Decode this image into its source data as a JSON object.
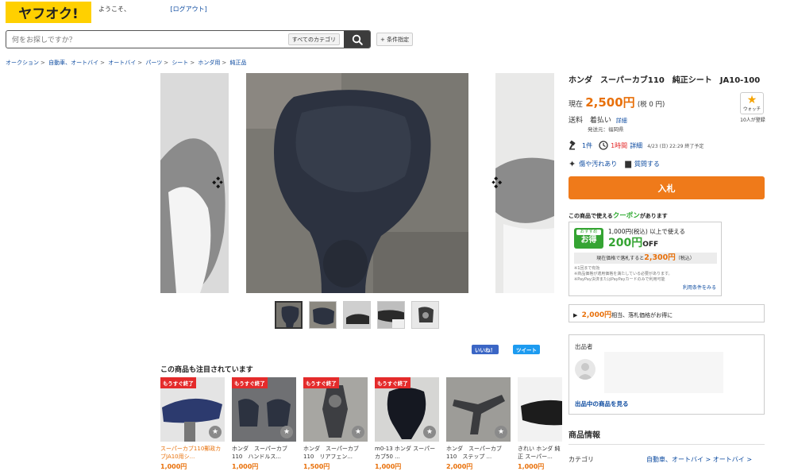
{
  "header": {
    "logo": "ヤフオク!",
    "welcome": "ようこそ、",
    "logout": "[ログアウト]"
  },
  "search": {
    "placeholder": "何をお探しですか？",
    "category": "すべてのカテゴリ",
    "search_icon": "search-icon",
    "conditions": "+ 条件指定"
  },
  "breadcrumbs": [
    "オークション",
    "自動車、オートバイ",
    "オートバイ",
    "パーツ",
    "シート",
    "ホンダ用",
    "純正品"
  ],
  "product": {
    "title": "ホンダ　スーパーカブ110　純正シート　JA10-100",
    "current_label": "現在",
    "price": "2,500円",
    "tax": "(税 0 円)",
    "watch_label": "ウォッチ",
    "watch_count": "10人が登録",
    "shipping_label": "送料",
    "shipping_value": "着払い",
    "shipping_detail": "詳細",
    "ship_from": "発送元：福岡県",
    "bid_count": "1件",
    "time_left": "1時間",
    "time_detail": "詳細",
    "end_time": "4/23 (日) 22:29 終了予定",
    "condition": "傷や汚れあり",
    "question": "質問する",
    "bid_button": "入札"
  },
  "coupon": {
    "heading_pre": "この商品で使える",
    "heading_em": "クーポン",
    "heading_post": "があります",
    "tag_small": "おすすめ",
    "tag_big": "お得",
    "line1": "1,000円(税込) 以上で使える",
    "amount": "200円",
    "off": "OFF",
    "bar_pre": "現在価格で落札すると",
    "bar_price": "2,300円",
    "bar_post": "（税込）",
    "note1": "※1回まで有効",
    "note2": "※商品価格が適用価格を満たしている必要があります。",
    "note3": "※PayPay決済またはPayPayカードのみで利用可能",
    "terms": "利用条件をみる"
  },
  "deal": {
    "price": "2,000円",
    "text": "相当、落札価格がお得に"
  },
  "seller": {
    "label": "出品者",
    "link": "出品中の商品を見る"
  },
  "info": {
    "heading": "商品情報",
    "category_label": "カテゴリ",
    "category_value": "自動車、オートバイ > オートバイ >"
  },
  "social": {
    "like": "いいね！",
    "tweet": "ツイート"
  },
  "also_viewed": {
    "title": "この商品も注目されています",
    "items": [
      {
        "badge": "もうすぐ終了",
        "title": "スーパーカブ110郵政カブJA10用シ...",
        "price": "1,000円"
      },
      {
        "badge": "もうすぐ終了",
        "title": "ホンダ　スーパーカブ110　ハンドルス...",
        "price": "1,000円"
      },
      {
        "badge": "もうすぐ終了",
        "title": "ホンダ　スーパーカブ110　リアフェン...",
        "price": "1,500円"
      },
      {
        "badge": "もうすぐ終了",
        "title": "m0-13 ホンダ スーパーカブ50 ...",
        "price": "1,000円"
      },
      {
        "badge": "",
        "title": "ホンダ　スーパーカブ110　ステップ ...",
        "price": "2,000円"
      },
      {
        "badge": "",
        "title": "きれい ホンダ 純正 スーパー...",
        "price": "1,000円"
      }
    ]
  },
  "colors": {
    "brand_yellow": "#ffd000",
    "price_orange": "#e8700a",
    "bid_button": "#ef7a1a",
    "coupon_green": "#35a433",
    "link_blue": "#0d4ba0"
  }
}
